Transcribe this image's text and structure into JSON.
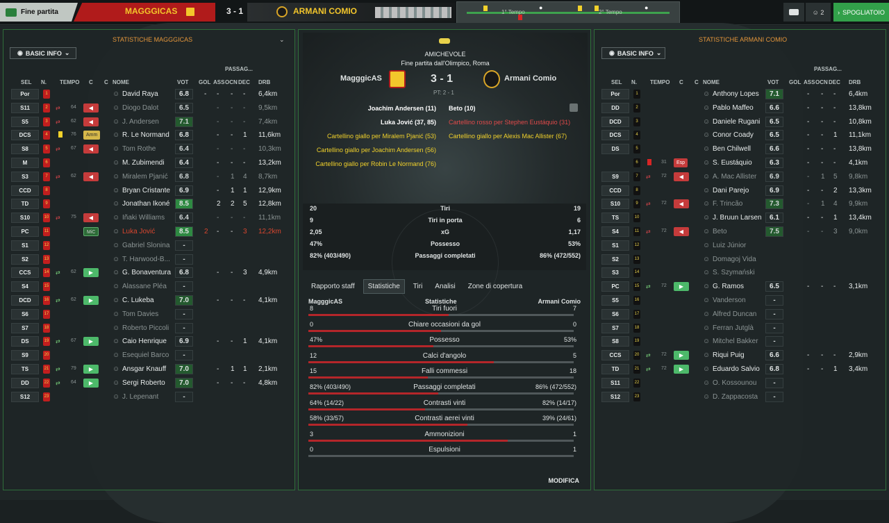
{
  "header": {
    "fine_partita": "Fine partita",
    "home": "MAGGGICAS",
    "score": "3 - 1",
    "away": "ARMANI COMIO",
    "tempo1": "1° Tempo",
    "tempo2": "2° Tempo",
    "players_count": "2",
    "spogliatoio": "SPOGLIATOIO"
  },
  "home_panel": {
    "title": "STATISTICHE MAGGGICAS",
    "basic_info": "BASIC INFO"
  },
  "away_panel": {
    "title": "STATISTICHE ARMANI COMIO",
    "basic_info": "BASIC INFO"
  },
  "cols": {
    "sel": "SEL",
    "n": "N.",
    "tempo": "TEMPO",
    "c": "C",
    "c2": "C",
    "nome": "NOME",
    "vot": "VOT",
    "gol": "GOL",
    "ass": "ASS",
    "passag": "PASSAG...",
    "ocn": "OCN",
    "dec": "DEC",
    "drb": "DRB"
  },
  "center": {
    "competition": "AMICHEVOLE",
    "venue": "Fine partita dall'Olimpico, Roma",
    "home": "MagggicAS",
    "score": "3 - 1",
    "away": "Armani Comio",
    "pt": "PT: 2 - 1",
    "events_left": [
      "Joachim Andersen (11)",
      "Luka Jović (37, 85)",
      "Cartellino giallo per Miralem Pjanić (53)",
      "Cartellino giallo per Joachim Andersen (56)",
      "Cartellino giallo per Robin Le Normand (76)"
    ],
    "events_right": [
      "Beto (10)",
      "Cartellino rosso per Stephen Eustáquio (31)",
      "Cartellino giallo per Alexis Mac Allister (67)"
    ],
    "summary": [
      {
        "l": "20",
        "label": "Tiri",
        "r": "19"
      },
      {
        "l": "9",
        "label": "Tiri in porta",
        "r": "6"
      },
      {
        "l": "2,05",
        "label": "xG",
        "r": "1,17"
      },
      {
        "l": "47%",
        "label": "Possesso",
        "r": "53%"
      },
      {
        "l": "82% (403/490)",
        "label": "Passaggi completati",
        "r": "86% (472/552)"
      }
    ],
    "tabs": [
      "Rapporto staff",
      "Statistiche",
      "Tiri",
      "Analisi",
      "Zone di copertura"
    ],
    "bars_head": {
      "home": "MagggicAS",
      "mid": "Statistiche",
      "away": "Armani Comio"
    },
    "bars": [
      {
        "l": "8",
        "label": "Tiri fuori",
        "r": "7",
        "p": 0.53
      },
      {
        "l": "0",
        "label": "Chiare occasioni da gol",
        "r": "0",
        "p": 0.5
      },
      {
        "l": "47%",
        "label": "Possesso",
        "r": "53%",
        "p": 0.47
      },
      {
        "l": "12",
        "label": "Calci d'angolo",
        "r": "5",
        "p": 0.7
      },
      {
        "l": "15",
        "label": "Falli commessi",
        "r": "18",
        "p": 0.45
      },
      {
        "l": "82% (403/490)",
        "label": "Passaggi completati",
        "r": "86% (472/552)",
        "p": 0.49
      },
      {
        "l": "64% (14/22)",
        "label": "Contrasti vinti",
        "r": "82% (14/17)",
        "p": 0.44
      },
      {
        "l": "58% (33/57)",
        "label": "Contrasti aerei vinti",
        "r": "39% (24/61)",
        "p": 0.6
      },
      {
        "l": "3",
        "label": "Ammonizioni",
        "r": "1",
        "p": 0.75
      },
      {
        "l": "0",
        "label": "Espulsioni",
        "r": "1",
        "p": 0.0
      }
    ],
    "modifica": "MODIFICA"
  },
  "home_players": [
    {
      "pos": "Por",
      "n": "1",
      "name": "David Raya",
      "vot": "6.8",
      "gol": "-",
      "ass": "-",
      "ocn": "-",
      "dec": "-",
      "drb": "6,4km"
    },
    {
      "pos": "S11",
      "n": "2",
      "name": "Diogo Dalot",
      "vot": "6.5",
      "gol": "",
      "ass": "-",
      "ocn": "-",
      "dec": "-",
      "drb": "9,5km",
      "dim": true,
      "out": "64"
    },
    {
      "pos": "S5",
      "n": "3",
      "name": "J. Andersen",
      "vot": "7.1",
      "gol": "",
      "ass": "-",
      "ocn": "-",
      "dec": "-",
      "drb": "7,4km",
      "dim": true,
      "out": "62"
    },
    {
      "pos": "DCS",
      "n": "4",
      "name": "R. Le Normand",
      "vot": "6.8",
      "gol": "",
      "ass": "-",
      "ocn": "-",
      "dec": "1",
      "drb": "11,6km",
      "in": "76",
      "tag": "Amm"
    },
    {
      "pos": "S8",
      "n": "5",
      "name": "Tom Rothe",
      "vot": "6.4",
      "gol": "",
      "ass": "-",
      "ocn": "-",
      "dec": "-",
      "drb": "10,3km",
      "dim": true,
      "out": "67"
    },
    {
      "pos": "M",
      "n": "6",
      "name": "M. Zubimendi",
      "vot": "6.4",
      "gol": "",
      "ass": "-",
      "ocn": "-",
      "dec": "-",
      "drb": "13,2km"
    },
    {
      "pos": "S3",
      "n": "7",
      "name": "Miralem Pjanić",
      "vot": "6.8",
      "gol": "",
      "ass": "-",
      "ocn": "1",
      "dec": "4",
      "drb": "8,7km",
      "dim": true,
      "out": "62"
    },
    {
      "pos": "CCD",
      "n": "8",
      "name": "Bryan Cristante",
      "vot": "6.9",
      "gol": "",
      "ass": "-",
      "ocn": "1",
      "dec": "1",
      "drb": "12,9km"
    },
    {
      "pos": "TD",
      "n": "9",
      "name": "Jonathan Ikoné",
      "vot": "8.5",
      "gol": "",
      "ass": "2",
      "ocn": "2",
      "dec": "5",
      "drb": "12,8km"
    },
    {
      "pos": "S10",
      "n": "10",
      "name": "Iñaki Williams",
      "vot": "6.4",
      "gol": "",
      "ass": "-",
      "ocn": "-",
      "dec": "-",
      "drb": "11,1km",
      "dim": true,
      "out": "75"
    },
    {
      "pos": "PC",
      "n": "11",
      "name": "Luka Jović",
      "vot": "8.5",
      "gol": "2",
      "ass": "-",
      "ocn": "-",
      "dec": "3",
      "drb": "12,2km",
      "red": true,
      "tag2": "MiC"
    },
    {
      "pos": "S1",
      "n": "12",
      "name": "Gabriel Slonina",
      "vot": "-",
      "gol": "",
      "ass": "",
      "ocn": "",
      "dec": "",
      "drb": "",
      "dim": true
    },
    {
      "pos": "S2",
      "n": "13",
      "name": "T. Harwood-B...",
      "vot": "-",
      "gol": "",
      "ass": "",
      "ocn": "",
      "dec": "",
      "drb": "",
      "dim": true
    },
    {
      "pos": "CCS",
      "n": "14",
      "name": "G. Bonaventura",
      "vot": "6.8",
      "gol": "",
      "ass": "-",
      "ocn": "-",
      "dec": "3",
      "drb": "4,9km",
      "inm": "62"
    },
    {
      "pos": "S4",
      "n": "15",
      "name": "Alassane Pléa",
      "vot": "-",
      "gol": "",
      "ass": "",
      "ocn": "",
      "dec": "",
      "drb": "",
      "dim": true
    },
    {
      "pos": "DCD",
      "n": "16",
      "name": "C. Lukeba",
      "vot": "7.0",
      "gol": "",
      "ass": "-",
      "ocn": "-",
      "dec": "-",
      "drb": "4,1km",
      "inm": "62"
    },
    {
      "pos": "S6",
      "n": "17",
      "name": "Tom Davies",
      "vot": "-",
      "gol": "",
      "ass": "",
      "ocn": "",
      "dec": "",
      "drb": "",
      "dim": true
    },
    {
      "pos": "S7",
      "n": "18",
      "name": "Roberto Piccoli",
      "vot": "-",
      "gol": "",
      "ass": "",
      "ocn": "",
      "dec": "",
      "drb": "",
      "dim": true
    },
    {
      "pos": "DS",
      "n": "19",
      "name": "Caio Henrique",
      "vot": "6.9",
      "gol": "",
      "ass": "-",
      "ocn": "-",
      "dec": "1",
      "drb": "4,1km",
      "inm": "67"
    },
    {
      "pos": "S9",
      "n": "20",
      "name": "Esequiel Barco",
      "vot": "-",
      "gol": "",
      "ass": "",
      "ocn": "",
      "dec": "",
      "drb": "",
      "dim": true
    },
    {
      "pos": "TS",
      "n": "21",
      "name": "Ansgar Knauff",
      "vot": "7.0",
      "gol": "",
      "ass": "-",
      "ocn": "1",
      "dec": "1",
      "drb": "2,1km",
      "inm": "79"
    },
    {
      "pos": "DD",
      "n": "22",
      "name": "Sergi Roberto",
      "vot": "7.0",
      "gol": "",
      "ass": "-",
      "ocn": "-",
      "dec": "-",
      "drb": "4,8km",
      "inm": "64"
    },
    {
      "pos": "S12",
      "n": "23",
      "name": "J. Lepenant",
      "vot": "-",
      "gol": "",
      "ass": "",
      "ocn": "",
      "dec": "",
      "drb": "",
      "dim": true
    }
  ],
  "away_players": [
    {
      "pos": "Por",
      "n": "1",
      "name": "Anthony Lopes",
      "vot": "7.1",
      "ass": "-",
      "ocn": "-",
      "dec": "-",
      "drb": "6,4km"
    },
    {
      "pos": "DD",
      "n": "2",
      "name": "Pablo Maffeo",
      "vot": "6.6",
      "ass": "-",
      "ocn": "-",
      "dec": "-",
      "drb": "13,8km"
    },
    {
      "pos": "DCD",
      "n": "3",
      "name": "Daniele Rugani",
      "vot": "6.5",
      "ass": "-",
      "ocn": "-",
      "dec": "-",
      "drb": "10,8km"
    },
    {
      "pos": "DCS",
      "n": "4",
      "name": "Conor Coady",
      "vot": "6.5",
      "ass": "-",
      "ocn": "-",
      "dec": "1",
      "drb": "11,1km"
    },
    {
      "pos": "DS",
      "n": "5",
      "name": "Ben Chilwell",
      "vot": "6.6",
      "ass": "-",
      "ocn": "-",
      "dec": "-",
      "drb": "13,8km"
    },
    {
      "pos": "",
      "n": "6",
      "name": "S. Eustáquio",
      "vot": "6.3",
      "ass": "-",
      "ocn": "-",
      "dec": "-",
      "drb": "4,1km",
      "tag": "Esp",
      "time": "31"
    },
    {
      "pos": "S9",
      "n": "7",
      "name": "A. Mac Allister",
      "vot": "6.9",
      "ass": "-",
      "ocn": "1",
      "dec": "5",
      "drb": "9,8km",
      "dim": true,
      "out": "72"
    },
    {
      "pos": "CCD",
      "n": "8",
      "name": "Dani Parejo",
      "vot": "6.9",
      "ass": "-",
      "ocn": "-",
      "dec": "2",
      "drb": "13,3km"
    },
    {
      "pos": "S10",
      "n": "9",
      "name": "F. Trincão",
      "vot": "7.3",
      "ass": "-",
      "ocn": "1",
      "dec": "4",
      "drb": "9,9km",
      "dim": true,
      "out": "72"
    },
    {
      "pos": "TS",
      "n": "10",
      "name": "J. Bruun Larsen",
      "vot": "6.1",
      "ass": "-",
      "ocn": "-",
      "dec": "1",
      "drb": "13,4km"
    },
    {
      "pos": "S4",
      "n": "11",
      "name": "Beto",
      "vot": "7.5",
      "ass": "-",
      "ocn": "-",
      "dec": "3",
      "drb": "9,0km",
      "dim": true,
      "out": "72"
    },
    {
      "pos": "S1",
      "n": "12",
      "name": "Luiz Júnior",
      "vot": "",
      "ass": "",
      "ocn": "",
      "dec": "",
      "drb": "",
      "dim": true
    },
    {
      "pos": "S2",
      "n": "13",
      "name": "Domagoj Vida",
      "vot": "",
      "ass": "",
      "ocn": "",
      "dec": "",
      "drb": "",
      "dim": true
    },
    {
      "pos": "S3",
      "n": "14",
      "name": "S. Szymański",
      "vot": "",
      "ass": "",
      "ocn": "",
      "dec": "",
      "drb": "",
      "dim": true
    },
    {
      "pos": "PC",
      "n": "15",
      "name": "G. Ramos",
      "vot": "6.5",
      "ass": "-",
      "ocn": "-",
      "dec": "-",
      "drb": "3,1km",
      "inm": "72"
    },
    {
      "pos": "S5",
      "n": "16",
      "name": "Vanderson",
      "vot": "-",
      "ass": "",
      "ocn": "",
      "dec": "",
      "drb": "",
      "dim": true
    },
    {
      "pos": "S6",
      "n": "17",
      "name": "Alfred Duncan",
      "vot": "-",
      "ass": "",
      "ocn": "",
      "dec": "",
      "drb": "",
      "dim": true
    },
    {
      "pos": "S7",
      "n": "18",
      "name": "Ferran Jutglà",
      "vot": "-",
      "ass": "",
      "ocn": "",
      "dec": "",
      "drb": "",
      "dim": true
    },
    {
      "pos": "S8",
      "n": "19",
      "name": "Mitchel Bakker",
      "vot": "-",
      "ass": "",
      "ocn": "",
      "dec": "",
      "drb": "",
      "dim": true
    },
    {
      "pos": "CCS",
      "n": "20",
      "name": "Riqui Puig",
      "vot": "6.6",
      "ass": "-",
      "ocn": "-",
      "dec": "-",
      "drb": "2,9km",
      "inm": "72"
    },
    {
      "pos": "TD",
      "n": "21",
      "name": "Eduardo Salvio",
      "vot": "6.8",
      "ass": "-",
      "ocn": "-",
      "dec": "1",
      "drb": "3,4km",
      "inm": "72"
    },
    {
      "pos": "S11",
      "n": "22",
      "name": "O. Kossounou",
      "vot": "-",
      "ass": "",
      "ocn": "",
      "dec": "",
      "drb": "",
      "dim": true
    },
    {
      "pos": "S12",
      "n": "23",
      "name": "D. Zappacosta",
      "vot": "-",
      "ass": "",
      "ocn": "",
      "dec": "",
      "drb": "",
      "dim": true
    }
  ]
}
